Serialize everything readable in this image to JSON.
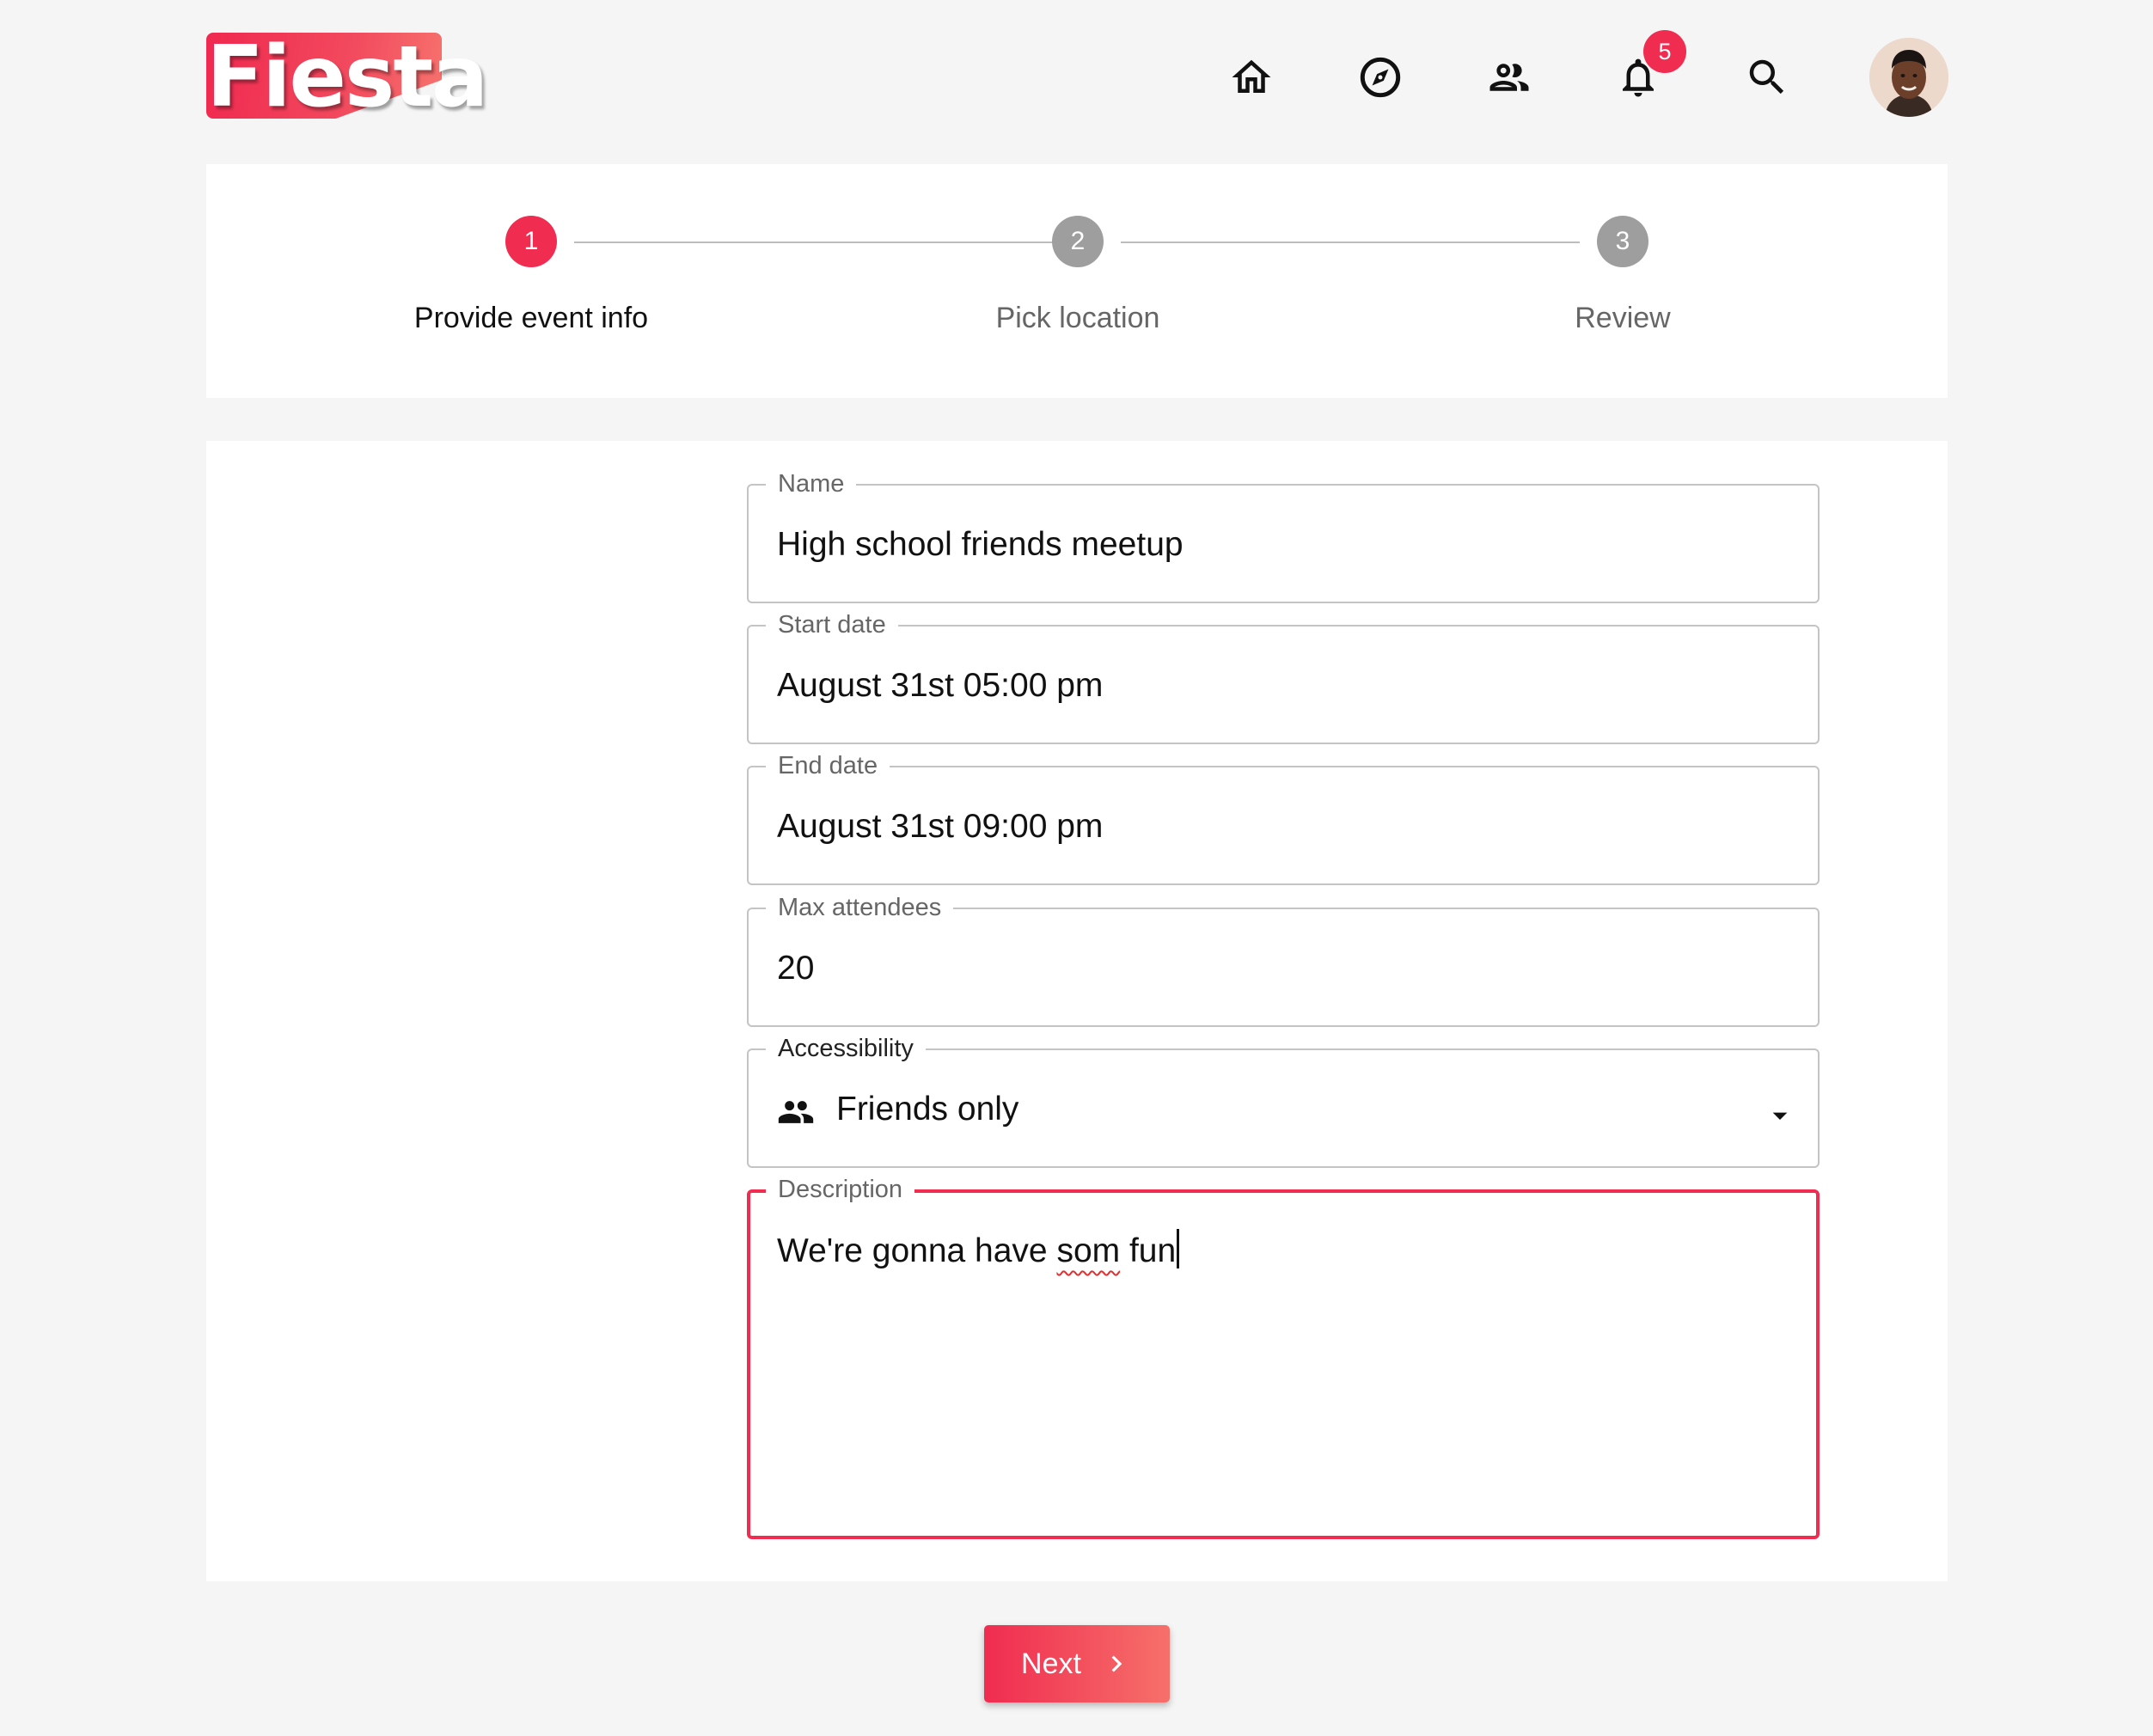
{
  "app": {
    "logo_text": "Fiesta",
    "accent_color": "#f02c50"
  },
  "nav": {
    "icons": [
      "home-icon",
      "explore-compass-icon",
      "friends-icon",
      "notifications-bell-icon",
      "search-icon"
    ],
    "notification_count": "5"
  },
  "stepper": {
    "steps": [
      {
        "number": "1",
        "label": "Provide event info",
        "state": "active"
      },
      {
        "number": "2",
        "label": "Pick location",
        "state": "inactive"
      },
      {
        "number": "3",
        "label": "Review",
        "state": "inactive"
      }
    ]
  },
  "form": {
    "name": {
      "label": "Name",
      "value": "High school friends meetup"
    },
    "start_date": {
      "label": "Start date",
      "value": "August 31st 05:00 pm"
    },
    "end_date": {
      "label": "End date",
      "value": "August 31st 09:00 pm"
    },
    "max_attendees": {
      "label": "Max attendees",
      "value": "20"
    },
    "accessibility": {
      "label": "Accessibility",
      "value": "Friends only",
      "icon": "people-icon"
    },
    "description": {
      "label": "Description",
      "value_before": "We're gonna have ",
      "misspelled": "som",
      "value_after": " fun"
    }
  },
  "actions": {
    "next_label": "Next"
  }
}
